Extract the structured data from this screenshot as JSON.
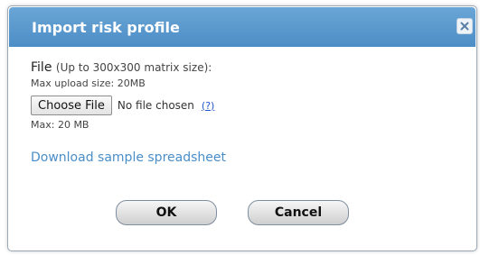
{
  "dialog": {
    "title": "Import risk profile",
    "close_icon": "close-icon"
  },
  "form": {
    "file_label": "File",
    "file_hint": "(Up to 300x300 matrix size):",
    "max_upload": "Max upload size: 20MB",
    "choose_file_label": "Choose File",
    "no_file_text": "No file chosen",
    "help_link": "(?)",
    "max_size": "Max: 20 MB",
    "download_link": "Download sample spreadsheet"
  },
  "buttons": {
    "ok": "OK",
    "cancel": "Cancel"
  },
  "colors": {
    "titlebar": "#5a9ad0",
    "link": "#4a8ec8"
  }
}
